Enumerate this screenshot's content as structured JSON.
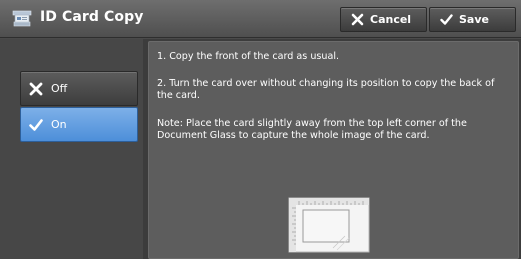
{
  "header": {
    "title": "ID Card Copy",
    "cancel_label": "Cancel",
    "save_label": "Save",
    "icons": {
      "title": "id-card-copy-icon",
      "cancel": "x-icon",
      "save": "checkmark-icon"
    }
  },
  "options": {
    "off_label": "Off",
    "on_label": "On",
    "selected": "On"
  },
  "instructions": {
    "step1": "1. Copy the front of the card as usual.",
    "step2": "2. Turn the card over without changing its position to copy the back of the card.",
    "note": "Note: Place the card slightly away from the top left corner of the Document Glass to capture the whole image of the card."
  },
  "colors": {
    "selected_accent": "#5a9ae0",
    "panel_bg": "#5d5d5d",
    "header_bg": "#5e5e5e"
  }
}
